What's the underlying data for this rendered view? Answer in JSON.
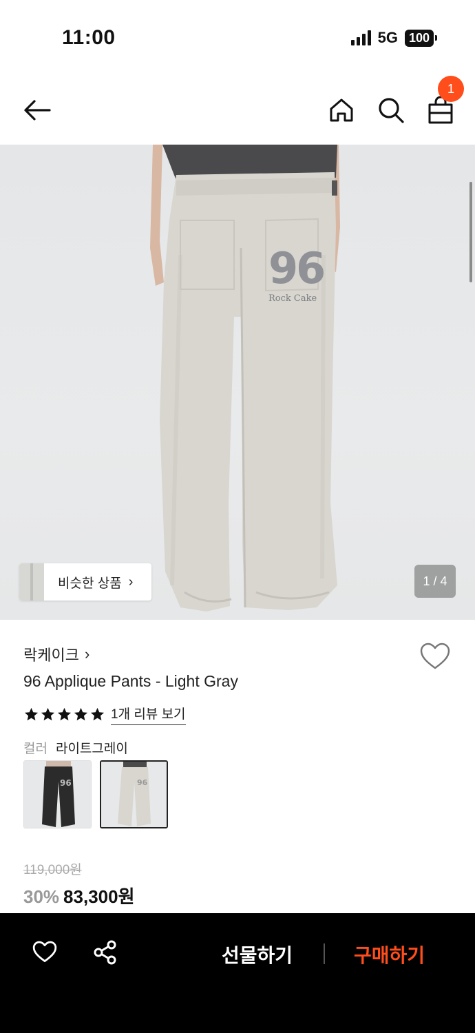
{
  "status_bar": {
    "time": "11:00",
    "network": "5G",
    "battery": "100"
  },
  "header": {
    "cart_count": "1",
    "icons": [
      "arrow-left-icon",
      "home-icon",
      "search-icon",
      "shopping-bag-icon"
    ]
  },
  "gallery": {
    "similar_label": "비슷한 상품",
    "counter": "1 / 4",
    "applique_number": "96",
    "applique_text": "Rock Cake"
  },
  "product": {
    "brand": "락케이크",
    "title": "96 Applique Pants - Light Gray",
    "rating_stars": 5,
    "review_link": "1개 리뷰 보기",
    "color_label": "컬러",
    "color_value": "라이트그레이",
    "swatches": [
      {
        "name": "black",
        "selected": false
      },
      {
        "name": "light-gray",
        "selected": true
      }
    ],
    "original_price": "119,000원",
    "discount": "30%",
    "sale_price": "83,300원"
  },
  "bottom_bar": {
    "gift_label": "선물하기",
    "buy_label": "구매하기"
  },
  "colors": {
    "accent": "#ff4d1c",
    "bottom_bar": "#000000",
    "pants": "#d8d6cf",
    "shirt": "#4a4a4c"
  }
}
